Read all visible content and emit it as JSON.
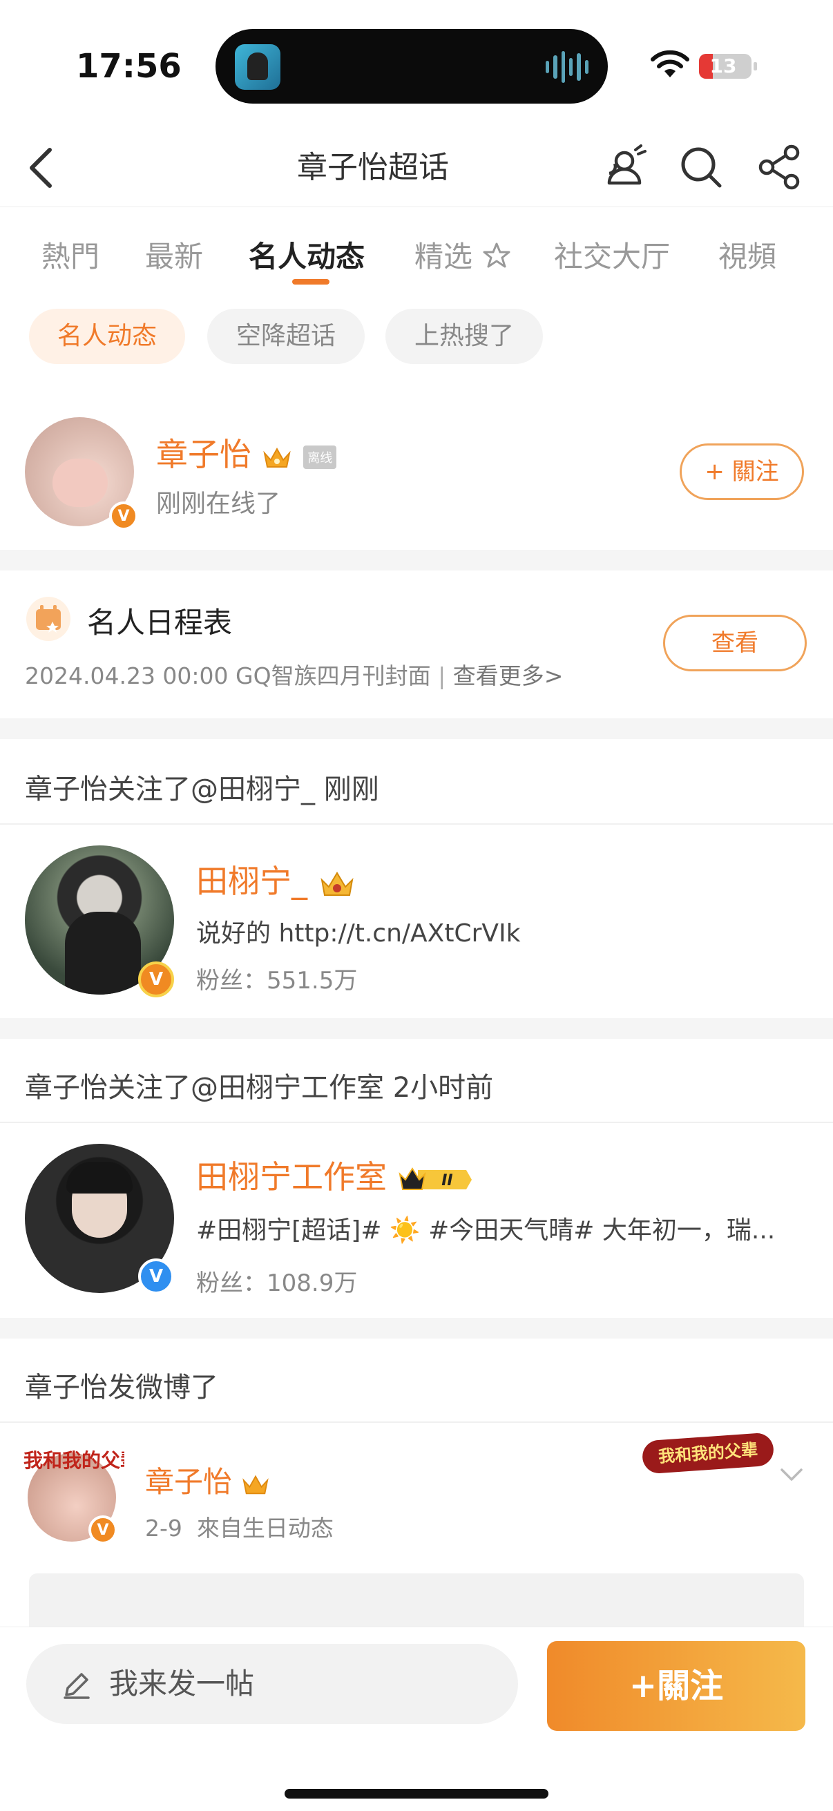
{
  "status_bar": {
    "time": "17:56",
    "battery": "13"
  },
  "header": {
    "title": "章子怡超话"
  },
  "tabs": [
    {
      "label": "熱門"
    },
    {
      "label": "最新"
    },
    {
      "label": "名人动态"
    },
    {
      "label": "精选"
    },
    {
      "label": "社交大厅"
    },
    {
      "label": "視頻"
    }
  ],
  "chips": [
    {
      "label": "名人动态"
    },
    {
      "label": "空降超话"
    },
    {
      "label": "上热搜了"
    }
  ],
  "celebrity": {
    "name": "章子怡",
    "offline_badge": "离线",
    "status": "刚刚在线了",
    "follow_label": "+ 關注"
  },
  "schedule": {
    "title": "名人日程表",
    "detail": "2024.04.23 00:00 GQ智族四月刊封面",
    "more": "查看更多>",
    "button": "查看"
  },
  "activities": [
    {
      "header": "章子怡关注了@田栩宁_ 刚刚",
      "name": "田栩宁_",
      "bio": "说好的 http://t.cn/AXtCrVIk",
      "fans": "粉丝：551.5万"
    },
    {
      "header": "章子怡关注了@田栩宁工作室 2小时前",
      "name": "田栩宁工作室",
      "level": "II",
      "bio": "#田栩宁[超话]# ☀️ #今田天气晴# 大年初一，瑞...",
      "fans": "粉丝：108.9万"
    }
  ],
  "post": {
    "header": "章子怡发微博了",
    "author": "章子怡",
    "meta": "2-9  來自生日动态",
    "avatar_frame_text": "我和我的父辈"
  },
  "bottom": {
    "compose_placeholder": "我来发一帖",
    "follow_label": "+關注"
  }
}
